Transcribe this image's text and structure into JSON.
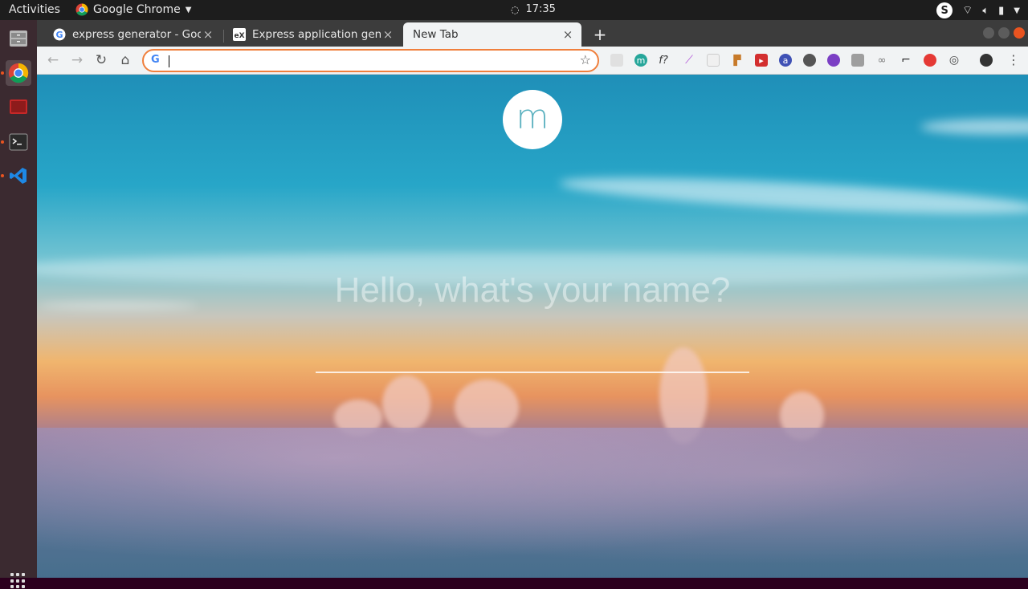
{
  "topbar": {
    "activities": "Activities",
    "app_name": "Google Chrome",
    "clock": "17:35",
    "skype": "S"
  },
  "tabs": [
    {
      "title": "express generator - Goog",
      "close": "×",
      "active": false
    },
    {
      "title": "Express application gene",
      "close": "×",
      "active": false
    },
    {
      "title": "New Tab",
      "close": "×",
      "active": true
    }
  ],
  "newtab_label": "+",
  "omnibox": {
    "value": "",
    "placeholder": ""
  },
  "page": {
    "logo_letter": "m",
    "greeting": "Hello, what's your name?",
    "name_value": ""
  },
  "extensions": [
    "ext-1",
    "ext-m",
    "ext-f",
    "ext-pen",
    "ext-4",
    "ext-5",
    "ext-6",
    "ext-7",
    "ext-8",
    "ext-9",
    "ext-10",
    "ext-11",
    "ext-12",
    "ext-13",
    "ext-14",
    "ext-15"
  ],
  "colors": {
    "omnibox_focus": "#f07f3c",
    "ubuntu_orange": "#e95420"
  }
}
